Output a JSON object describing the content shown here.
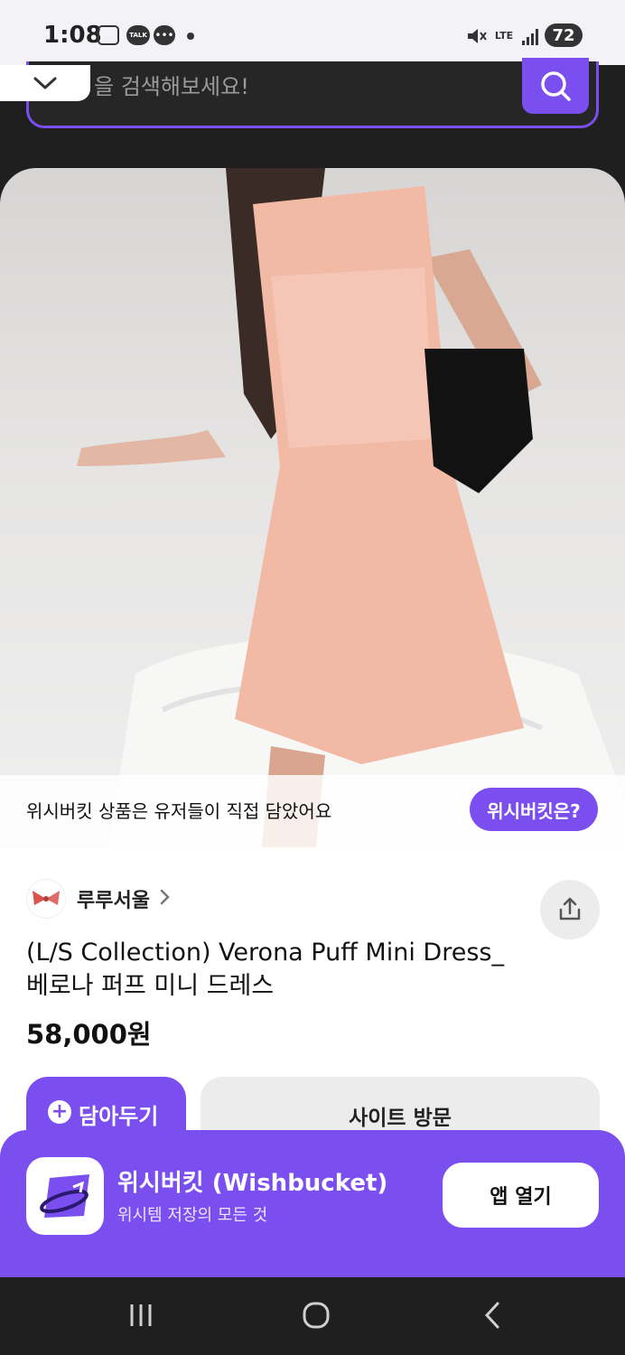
{
  "status_bar": {
    "time": "1:08",
    "talk_label": "TALK",
    "network": "LTE",
    "battery": "72"
  },
  "search": {
    "placeholder": "을 검색해보세요!"
  },
  "image_notice": {
    "text": "위시버킷 상품은 유저들이 직접 담았어요",
    "about_button": "위시버킷은?"
  },
  "product": {
    "seller": "루루서울",
    "title": "(L/S Collection) Verona Puff Mini Dress_베로나 퍼프 미니 드레스",
    "price": "58,000원"
  },
  "actions": {
    "save_label": "담아두기",
    "visit_label": "사이트 방문"
  },
  "app_banner": {
    "name": "위시버킷 (Wishbucket)",
    "tagline": "위시템 저장의 모든 것",
    "open_label": "앱 열기"
  },
  "colors": {
    "accent": "#7b4ef0",
    "dark": "#1f1f1f"
  }
}
